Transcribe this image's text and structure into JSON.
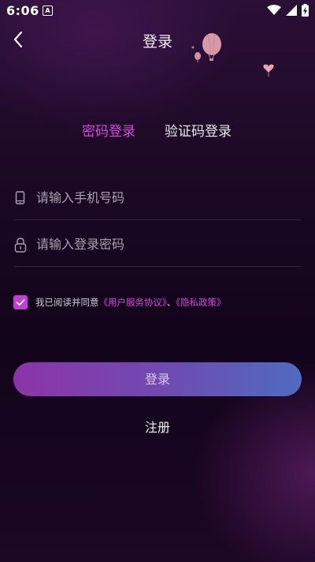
{
  "status_bar": {
    "time": "6:06",
    "notification_letter": "A"
  },
  "header": {
    "title": "登录"
  },
  "tabs": {
    "password_login": "密码登录",
    "code_login": "验证码登录"
  },
  "form": {
    "phone_placeholder": "请输入手机号码",
    "password_placeholder": "请输入登录密码"
  },
  "agreement": {
    "prefix": "我已阅读并同意",
    "user_agreement": "《用户服务协议》",
    "separator": "、",
    "privacy_policy": "《隐私政策》",
    "checked": true
  },
  "actions": {
    "login_label": "登录",
    "register_label": "注册"
  },
  "colors": {
    "accent": "#d54ae0",
    "button_start": "#8c34a8",
    "button_end": "#4f6bc0",
    "background": "#1a0822"
  }
}
